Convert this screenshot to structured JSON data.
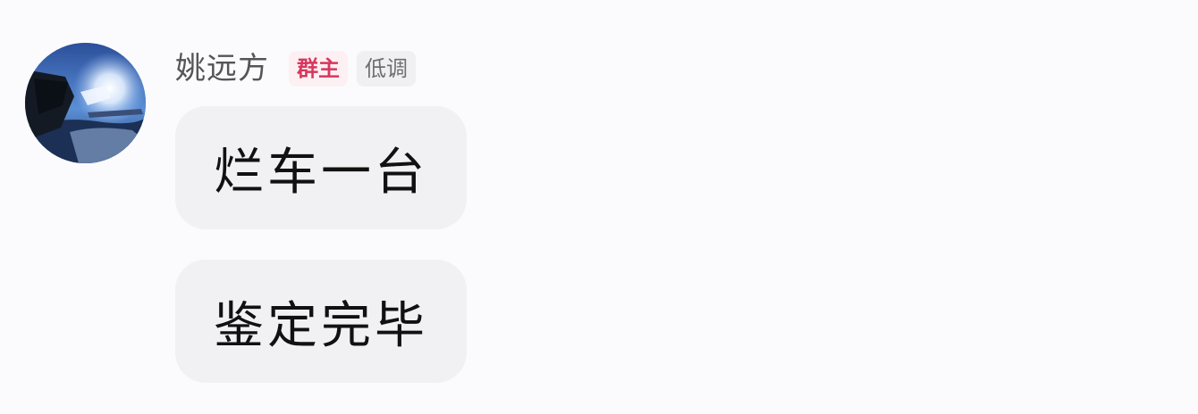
{
  "message": {
    "sender": {
      "name": "姚远方",
      "avatar": "user-avatar-photo"
    },
    "badges": {
      "owner": "群主",
      "title": "低调"
    },
    "bubbles": [
      {
        "text": "烂车一台"
      },
      {
        "text": "鉴定完毕"
      }
    ]
  },
  "colors": {
    "background": "#fbfbfd",
    "bubble": "#f1f1f4",
    "owner_badge_text": "#d8375d",
    "owner_badge_bg": "#fdf0f3"
  }
}
